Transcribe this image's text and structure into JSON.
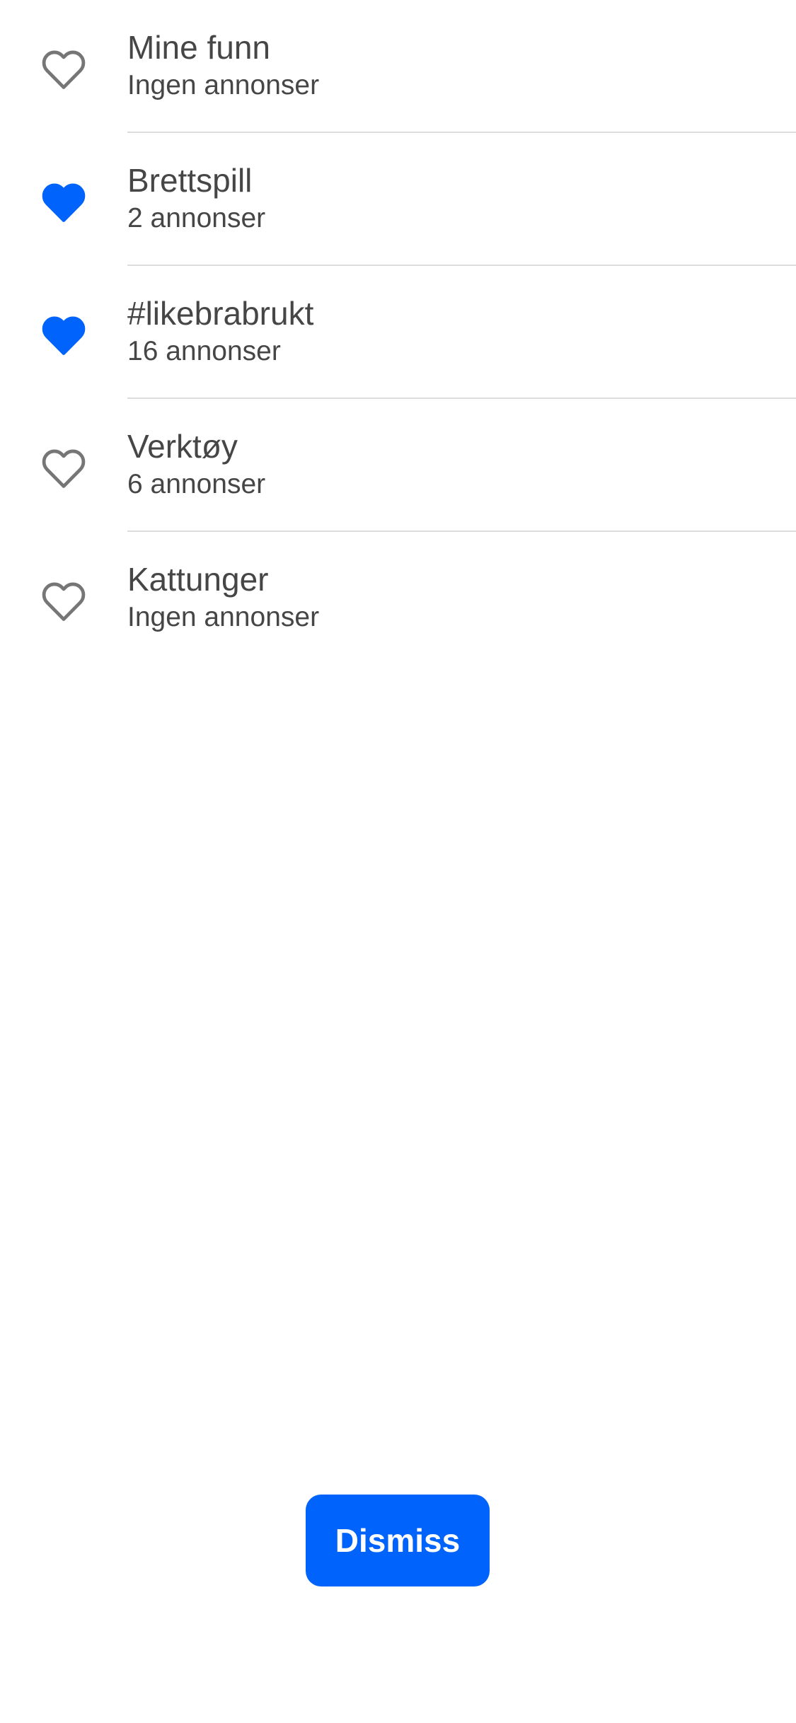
{
  "lists": [
    {
      "title": "Mine funn",
      "subtitle": "Ingen annonser",
      "favorited": false
    },
    {
      "title": "Brettspill",
      "subtitle": "2 annonser",
      "favorited": true
    },
    {
      "title": "#likebrabrukt",
      "subtitle": "16 annonser",
      "favorited": true
    },
    {
      "title": "Verktøy",
      "subtitle": "6 annonser",
      "favorited": false
    },
    {
      "title": "Kattunger",
      "subtitle": "Ingen annonser",
      "favorited": false
    }
  ],
  "icons": {
    "favorited": "heart-filled-icon",
    "not_favorited": "heart-outline-icon"
  },
  "colors": {
    "accent": "#0063fb",
    "heart_filled": "#0063fb",
    "heart_outline": "#767676",
    "text": "#464646",
    "divider": "#dcdcdc"
  },
  "dismiss_button": {
    "label": "Dismiss"
  }
}
